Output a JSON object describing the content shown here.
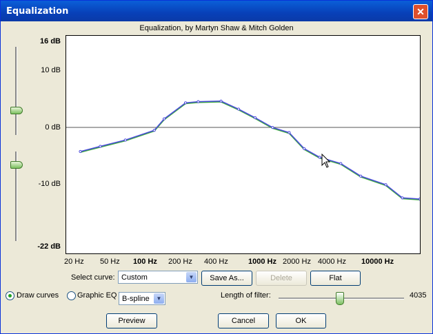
{
  "window": {
    "title": "Equalization"
  },
  "plot": {
    "title": "Equalization, by Martyn Shaw & Mitch Golden",
    "y_labels": [
      "16 dB",
      "10 dB",
      "0 dB",
      "-10 dB",
      "-22 dB"
    ],
    "x_labels": [
      "20 Hz",
      "50 Hz",
      "100 Hz",
      "200 Hz",
      "400 Hz",
      "1000 Hz",
      "2000 Hz",
      "4000 Hz",
      "10000 Hz"
    ],
    "colors": {
      "curve_blue": "#4a4adc",
      "curve_green": "#3faa3f",
      "zero_line": "#555555"
    }
  },
  "chart_data": {
    "type": "line",
    "title": "Equalization, by Martyn Shaw & Mitch Golden",
    "xscale": "log",
    "ylim": [
      -22,
      16
    ],
    "x": [
      20,
      30,
      50,
      90,
      110,
      170,
      220,
      350,
      500,
      700,
      1000,
      1400,
      1900,
      2600,
      4000,
      6000,
      10000,
      14000,
      20000
    ],
    "series": [
      {
        "values": [
          -4.2,
          -3.3,
          -2.2,
          -0.5,
          1.5,
          4.3,
          4.5,
          4.6,
          3.2,
          1.7,
          0,
          -0.9,
          -3.7,
          -5.2,
          -6.3,
          -8.5,
          -10,
          -12.3,
          -12.5
        ]
      }
    ]
  },
  "controls": {
    "select_curve_label": "Select curve:",
    "curve_value": "Custom",
    "save_as": "Save As...",
    "delete": "Delete",
    "flat": "Flat",
    "draw_curves": "Draw curves",
    "graphic_eq": "Graphic EQ",
    "interp_value": "B-spline",
    "filter_length_label": "Length of filter:",
    "filter_length_value": "4035",
    "preview": "Preview",
    "cancel": "Cancel",
    "ok": "OK"
  }
}
